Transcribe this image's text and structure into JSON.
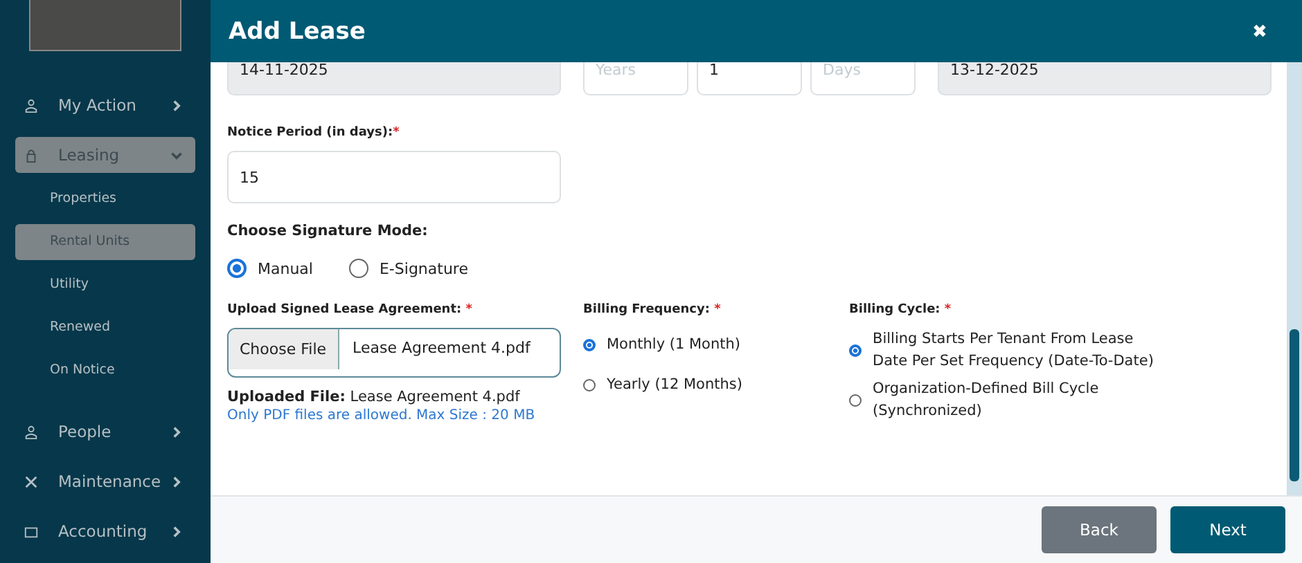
{
  "sidebar": {
    "items": [
      {
        "label": "My Action",
        "kind": "person",
        "selected": false,
        "expanded": false
      },
      {
        "label": "Leasing",
        "kind": "lock",
        "selected": true,
        "expanded": true,
        "children": [
          {
            "label": "Properties",
            "selected": false
          },
          {
            "label": "Rental Units",
            "selected": true
          },
          {
            "label": "Utility",
            "selected": false
          },
          {
            "label": "Renewed",
            "selected": false
          },
          {
            "label": "On Notice",
            "selected": false
          }
        ]
      },
      {
        "label": "People",
        "kind": "person",
        "selected": false,
        "expanded": false
      },
      {
        "label": "Maintenance",
        "kind": "tools",
        "selected": false,
        "expanded": false
      },
      {
        "label": "Accounting",
        "kind": "wallet",
        "selected": false,
        "expanded": false
      }
    ]
  },
  "dialog": {
    "title": "Add Lease",
    "close": "✖",
    "term_row": [
      {
        "value": "14-11-2025",
        "disabled": true
      },
      {
        "placeholder": "Years",
        "disabled": false
      },
      {
        "value": "1",
        "disabled": false
      },
      {
        "placeholder": "Days",
        "disabled": false
      },
      {
        "value": "13-12-2025",
        "disabled": true
      }
    ],
    "notice": {
      "label": "Notice Period (in days):",
      "required_mark": "*",
      "value": "15"
    },
    "signature": {
      "label": "Choose Signature Mode:",
      "options": [
        {
          "label": "Manual",
          "selected": true
        },
        {
          "label": "E-Signature",
          "selected": false
        }
      ]
    },
    "upload": {
      "label": "Upload Signed Lease Agreement:",
      "required_mark": "*",
      "button": "Choose File",
      "file_name": "Lease Agreement 4.pdf",
      "uploaded": "**Uploaded File:** Lease Agreement 4.pdf",
      "hint": "Only PDF files are allowed. Max Size : 20 MB"
    },
    "billing_frequency": {
      "label": "Billing Frequency:",
      "required_mark": "*",
      "options": [
        {
          "label": "Monthly (1 Month)",
          "selected": true
        },
        {
          "label": "Yearly (12 Months)",
          "selected": false
        }
      ]
    },
    "billing_cycle": {
      "label": "Billing Cycle:",
      "required_mark": "*",
      "options": [
        {
          "label": "Billing Starts Per Tenant From Lease Date Per Set Frequency (Date-To-Date)",
          "selected": true
        },
        {
          "label": "Organization-Defined Bill Cycle (Synchronized)",
          "selected": false
        }
      ]
    },
    "buttons": [
      {
        "label": "Back",
        "kind": "secondary"
      },
      {
        "label": "Next",
        "kind": "primary"
      }
    ]
  }
}
